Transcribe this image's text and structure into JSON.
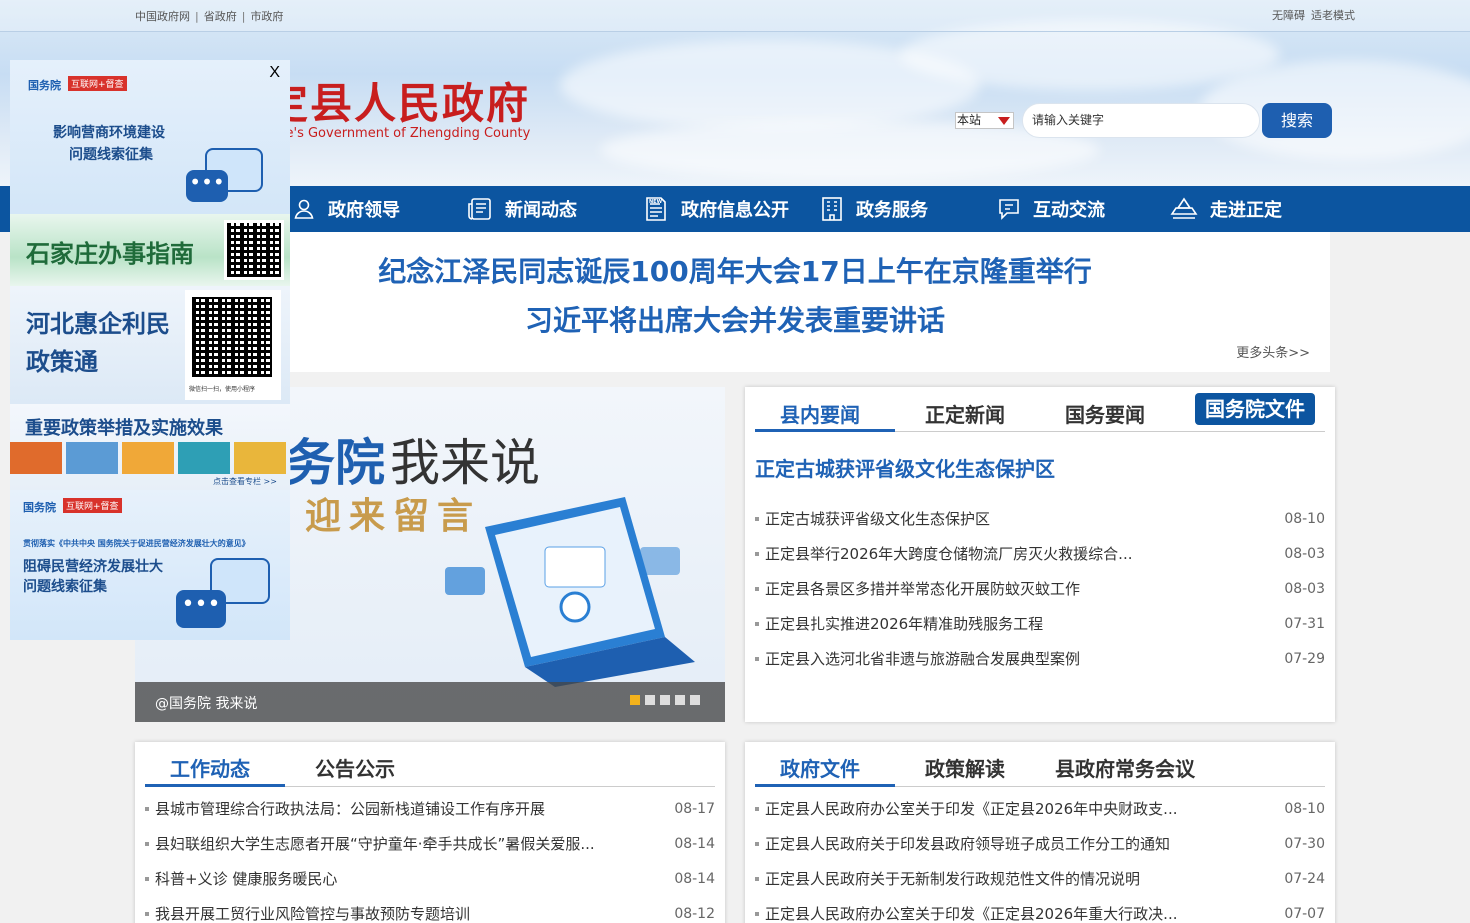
{
  "colors": {
    "brand_blue": "#0c55a0",
    "logo_red": "#c81e1e",
    "link_blue": "#1f62b5",
    "active_dot": "#f3b21c"
  },
  "topbar": {
    "links": [
      "中国政府网",
      "省政府",
      "市政府"
    ],
    "separator": "|",
    "right_links": [
      "无障碍",
      "适老模式"
    ]
  },
  "logo": {
    "cn": "正定县人民政府",
    "en": "The People's Government  of Zhengding County"
  },
  "search": {
    "scope": "本站",
    "placeholder": "请输入关键字",
    "button": "搜索"
  },
  "nav": [
    {
      "label": "政府领导",
      "icon": "user-icon"
    },
    {
      "label": "新闻动态",
      "icon": "news-icon"
    },
    {
      "label": "政府信息公开",
      "icon": "document-icon"
    },
    {
      "label": "政务服务",
      "icon": "building-icon"
    },
    {
      "label": "互动交流",
      "icon": "chat-icon"
    },
    {
      "label": "走进正定",
      "icon": "landmark-icon"
    }
  ],
  "headline": {
    "line1": "纪念江泽民同志诞辰100周年大会17日上午在京隆重举行",
    "line2": "习近平将出席大会并发表重要讲话",
    "more": "更多头条>>"
  },
  "banner": {
    "title_a": "务院",
    "title_b": "我来说",
    "title_c": "迎来留言",
    "caption": "@国务院 我来说",
    "slide_count": 5,
    "active_slide": 1
  },
  "news_panel": {
    "tabs": [
      "县内要闻",
      "正定新闻",
      "国务要闻",
      "国务院文件"
    ],
    "active_tab": 0,
    "feature": "正定古城获评省级文化生态保护区",
    "items": [
      {
        "title": "正定古城获评省级文化生态保护区",
        "date": "08-10"
      },
      {
        "title": "正定县举行2026年大跨度仓储物流厂房灭火救援综合...",
        "date": "08-03"
      },
      {
        "title": "正定县各景区多措并举常态化开展防蚊灭蚊工作",
        "date": "08-03"
      },
      {
        "title": "正定县扎实推进2026年精准助残服务工程",
        "date": "07-31"
      },
      {
        "title": "正定县入选河北省非遗与旅游融合发展典型案例",
        "date": "07-29"
      }
    ]
  },
  "work_panel": {
    "tabs": [
      "工作动态",
      "公告公示"
    ],
    "active_tab": 0,
    "items": [
      {
        "title": "县城市管理综合行政执法局：公园新栈道铺设工作有序开展",
        "date": "08-17"
      },
      {
        "title": "县妇联组织大学生志愿者开展“守护童年·牵手共成长”暑假关爱服...",
        "date": "08-14"
      },
      {
        "title": "科普+义诊 健康服务暖民心",
        "date": "08-14"
      },
      {
        "title": "我县开展工贸行业风险管控与事故预防专题培训",
        "date": "08-12"
      }
    ]
  },
  "docs_panel": {
    "tabs": [
      "政府文件",
      "政策解读",
      "县政府常务会议"
    ],
    "active_tab": 0,
    "items": [
      {
        "title": "正定县人民政府办公室关于印发《正定县2026年中央财政支...",
        "date": "08-10"
      },
      {
        "title": "正定县人民政府关于印发县政府领导班子成员工作分工的通知",
        "date": "07-30"
      },
      {
        "title": "正定县人民政府关于无新制发行政规范性文件的情况说明",
        "date": "07-24"
      },
      {
        "title": "正定县人民政府办公室关于印发《正定县2026年重大行政决...",
        "date": "07-07"
      }
    ]
  },
  "float_ads": {
    "close": "X",
    "ad1": {
      "org": "国务院",
      "tag": "互联网+督查",
      "line1": "影响营商环境建设",
      "line2": "问题线索征集"
    },
    "ad2": {
      "text": "石家庄办事指南"
    },
    "ad3": {
      "line1": "河北惠企利民",
      "line2": "政策通",
      "qr_note": "微信扫一扫，使用小程序"
    },
    "ad4": {
      "title": "重要政策举措及实施效果",
      "link": "点击查看专栏 >>"
    },
    "ad5": {
      "org": "国务院",
      "tag": "互联网+督查",
      "sub": "贯彻落实《中共中央 国务院关于促进民营经济发展壮大的意见》",
      "line1": "阻碍民营经济发展壮大",
      "line2": "问题线索征集"
    }
  }
}
